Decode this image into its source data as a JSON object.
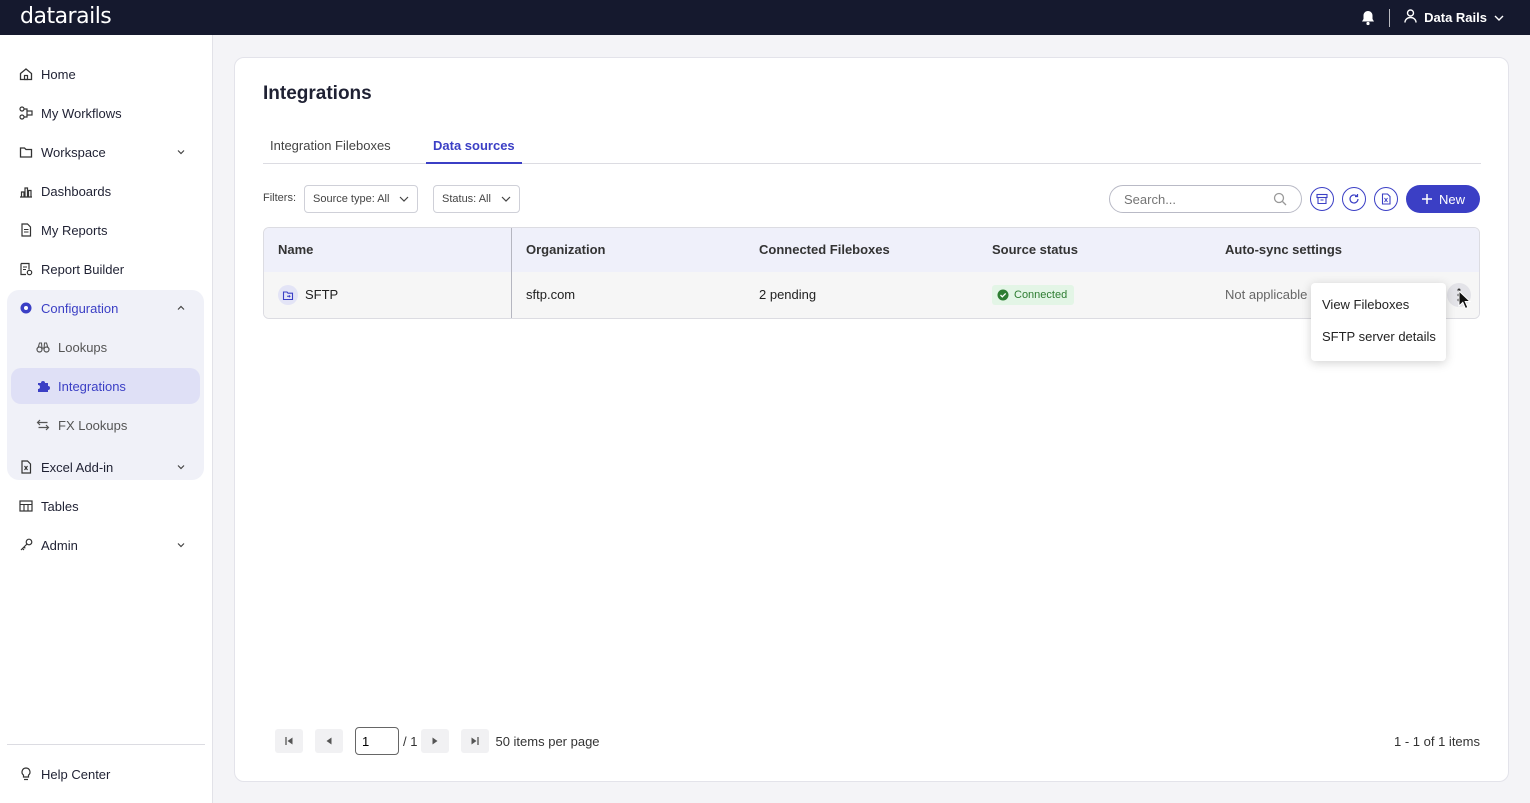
{
  "app": {
    "logo": "datarails",
    "user_name": "Data Rails"
  },
  "sidebar": {
    "items": [
      {
        "label": "Home",
        "icon": "home-icon"
      },
      {
        "label": "My Workflows",
        "icon": "workflow-icon"
      },
      {
        "label": "Workspace",
        "icon": "folder-icon"
      },
      {
        "label": "Dashboards",
        "icon": "bar-chart-icon"
      },
      {
        "label": "My Reports",
        "icon": "document-icon"
      },
      {
        "label": "Report Builder",
        "icon": "report-builder-icon"
      },
      {
        "label": "Configuration",
        "icon": "gear-icon"
      },
      {
        "label": "Lookups",
        "icon": "binoculars-icon"
      },
      {
        "label": "Integrations",
        "icon": "puzzle-icon"
      },
      {
        "label": "FX Lookups",
        "icon": "exchange-icon"
      },
      {
        "label": "Excel Add-in",
        "icon": "excel-icon"
      },
      {
        "label": "Tables",
        "icon": "table-icon"
      },
      {
        "label": "Admin",
        "icon": "key-icon"
      }
    ],
    "help": "Help Center"
  },
  "page": {
    "title": "Integrations",
    "tabs": [
      "Integration Fileboxes",
      "Data sources"
    ],
    "filters_label": "Filters:",
    "filter_source": "Source type: All",
    "filter_status": "Status: All",
    "search_placeholder": "Search...",
    "new_label": "New"
  },
  "table": {
    "columns": [
      "Name",
      "Organization",
      "Connected Fileboxes",
      "Source status",
      "Auto-sync settings"
    ],
    "rows": [
      {
        "name": "SFTP",
        "organization": "sftp.com",
        "fileboxes": "2 pending",
        "status": "Connected",
        "autosync": "Not applicable"
      }
    ]
  },
  "menu": {
    "items": [
      "View Fileboxes",
      "SFTP server details"
    ]
  },
  "pagination": {
    "page": "1",
    "total": "/ 1",
    "per_page": "50 items per page",
    "summary": "1 - 1 of 1 items"
  },
  "colors": {
    "accent": "#3b3fc5",
    "topbar": "#15192e",
    "success": "#2e7d32"
  }
}
